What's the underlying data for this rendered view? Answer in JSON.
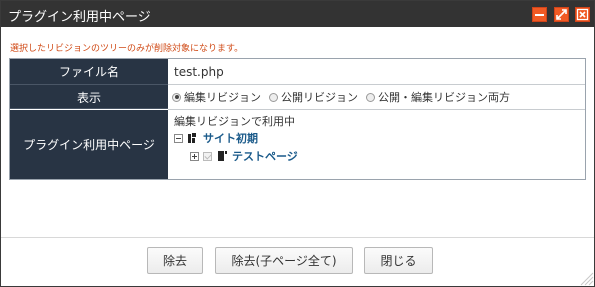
{
  "window": {
    "title": "プラグイン利用中ページ"
  },
  "notice": "選択したリビジョンのツリーのみが削除対象になります。",
  "rows": {
    "filename": {
      "label": "ファイル名",
      "value": "test.php"
    },
    "display": {
      "label": "表示",
      "options": [
        {
          "label": "編集リビジョン",
          "selected": true
        },
        {
          "label": "公開リビジョン",
          "selected": false
        },
        {
          "label": "公開・編集リビジョン両方",
          "selected": false
        }
      ]
    },
    "plugin_pages": {
      "label": "プラグイン利用中ページ",
      "usage_text": "編集リビジョンで利用中",
      "tree": {
        "root": {
          "label": "サイト初期",
          "expanded": true
        },
        "child": {
          "label": "テストページ",
          "checked": true,
          "expanded": false
        }
      }
    }
  },
  "buttons": {
    "remove": "除去",
    "remove_all_children": "除去(子ページ全て)",
    "close": "閉じる"
  },
  "colors": {
    "titlebar": "#333333",
    "accent": "#f15a24",
    "label_bg": "#283444",
    "notice": "#d04a16",
    "link": "#1a5a8a"
  }
}
